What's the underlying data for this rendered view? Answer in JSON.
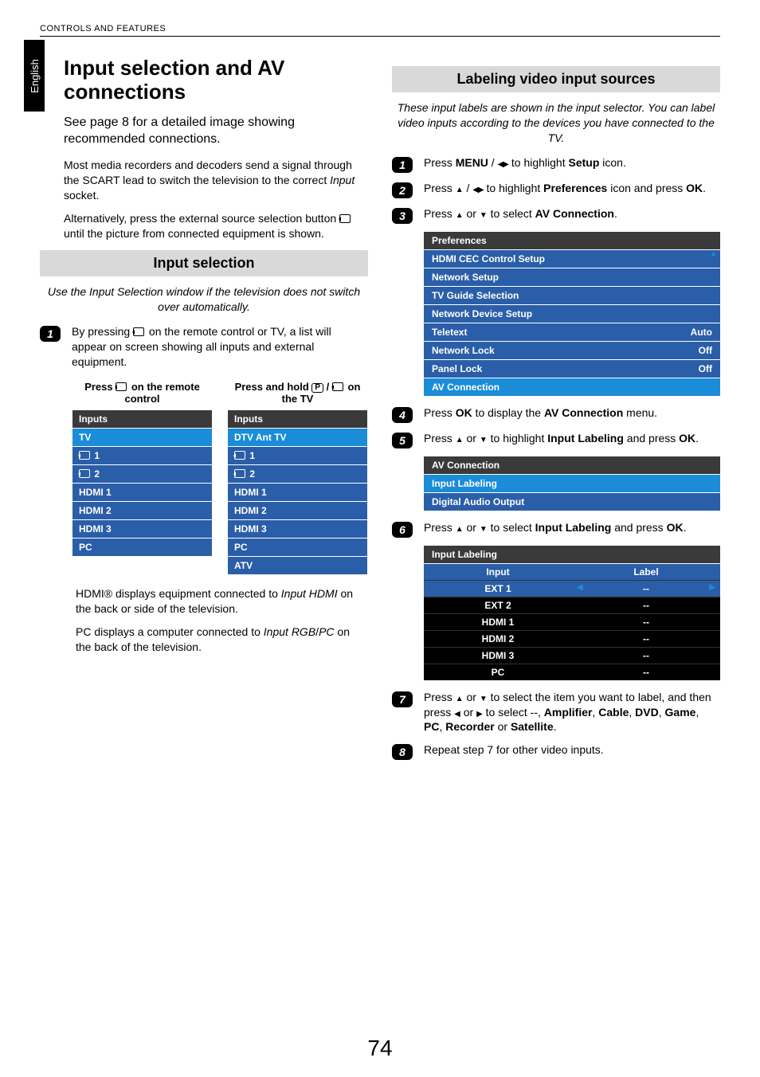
{
  "header": {
    "section": "CONTROLS AND FEATURES",
    "lang_tab": "English"
  },
  "left": {
    "title": "Input selection and AV connections",
    "lead": "See page 8 for a detailed image showing recommended connections.",
    "p1a": "Most media recorders and decoders send a signal through the SCART lead to switch the television to the correct ",
    "p1b": "Input",
    "p1c": " socket.",
    "p2a": "Alternatively, press the external source selection button ",
    "p2b": " until the picture from connected equipment is shown.",
    "sub1": "Input selection",
    "sub1_note": "Use the Input Selection window if the television does not switch over automatically.",
    "step1a": "By pressing ",
    "step1b": " on the remote control or TV, a list will appear on screen showing all inputs and external equipment.",
    "tbl_left_caption_a": "Press ",
    "tbl_left_caption_b": " on the remote control",
    "tbl_right_caption_a": "Press and hold ",
    "tbl_right_caption_b": " on the TV",
    "tbl_head": "Inputs",
    "tbl_left_rows": [
      "TV",
      "1",
      "2",
      "HDMI 1",
      "HDMI 2",
      "HDMI 3",
      "PC"
    ],
    "tbl_right_rows": [
      "DTV Ant TV",
      "1",
      "2",
      "HDMI 1",
      "HDMI 2",
      "HDMI 3",
      "PC",
      "ATV"
    ],
    "p3a": "HDMI® displays equipment connected to ",
    "p3b": "Input HDMI",
    "p3c": " on the back or side of the television.",
    "p4a": "PC displays a computer connected to ",
    "p4b": "Input RGB",
    "p4c": "/",
    "p4d": "PC",
    "p4e": " on the back of the television."
  },
  "right": {
    "sub2": "Labeling video input sources",
    "sub2_note": "These input labels are shown in the input selector. You can label video inputs according to the devices you have connected to the TV.",
    "s1a": "Press ",
    "s1b": "MENU",
    "s1c": " / ",
    "s1d": " to highlight ",
    "s1e": "Setup",
    "s1f": " icon.",
    "s2a": "Press ",
    "s2b": " / ",
    "s2c": " to highlight ",
    "s2d": "Preferences",
    "s2e": " icon and press ",
    "s2f": "OK",
    "s2g": ".",
    "s3a": "Press ",
    "s3b": " or ",
    "s3c": " to select ",
    "s3d": "AV Connection",
    "s3e": ".",
    "prefs": {
      "title": "Preferences",
      "rows": [
        [
          "HDMI CEC Control Setup",
          ""
        ],
        [
          "Network Setup",
          ""
        ],
        [
          "TV Guide Selection",
          ""
        ],
        [
          "Network Device Setup",
          ""
        ],
        [
          "Teletext",
          "Auto"
        ],
        [
          "Network Lock",
          "Off"
        ],
        [
          "Panel Lock",
          "Off"
        ],
        [
          "AV Connection",
          ""
        ]
      ],
      "hl_index": 7
    },
    "s4a": "Press ",
    "s4b": "OK",
    "s4c": " to display the ",
    "s4d": "AV Connection",
    "s4e": " menu.",
    "s5a": "Press ",
    "s5b": " or ",
    "s5c": " to highlight ",
    "s5d": "Input Labeling",
    "s5e": " and press ",
    "s5f": "OK",
    "s5g": ".",
    "avc": {
      "title": "AV Connection",
      "rows": [
        "Input Labeling",
        "Digital Audio Output"
      ],
      "hl_index": 0
    },
    "s6a": "Press ",
    "s6b": " or ",
    "s6c": " to select ",
    "s6d": "Input Labeling",
    "s6e": " and press ",
    "s6f": "OK",
    "s6g": ".",
    "il": {
      "title": "Input Labeling",
      "col1": "Input",
      "col2": "Label",
      "rows": [
        [
          "EXT 1",
          "--"
        ],
        [
          "EXT 2",
          "--"
        ],
        [
          "HDMI 1",
          "--"
        ],
        [
          "HDMI 2",
          "--"
        ],
        [
          "HDMI 3",
          "--"
        ],
        [
          "PC",
          "--"
        ]
      ],
      "hl_index": 0
    },
    "s7a": "Press ",
    "s7b": " or ",
    "s7c": " to select the item you want to label, and then press ",
    "s7d": " or ",
    "s7e": " to select --, ",
    "s7f": "Amplifier",
    "s7g": ", ",
    "s7h": "Cable",
    "s7i": ", ",
    "s7j": "DVD",
    "s7k": ", ",
    "s7l": "Game",
    "s7m": ", ",
    "s7n": "PC",
    "s7o": ", ",
    "s7p": "Recorder",
    "s7q": " or ",
    "s7r": "Satellite",
    "s7s": ".",
    "s8": "Repeat step 7 for other video inputs."
  },
  "page_number": "74"
}
